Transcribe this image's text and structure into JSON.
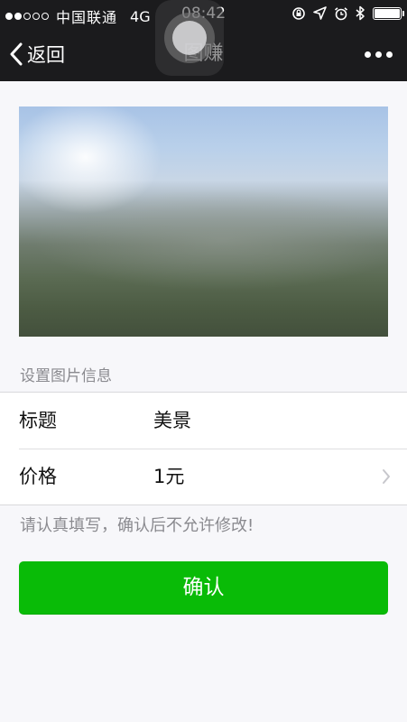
{
  "status_bar": {
    "signal_dots": {
      "filled": 2,
      "total": 5
    },
    "carrier": "中国联通",
    "network": "4G",
    "time": "08:42",
    "battery_level": 1.0
  },
  "nav": {
    "back_label": "返回",
    "title": "图赚",
    "more_icon": "more-dots-icon"
  },
  "photo": {
    "description_icon": "landscape-photo"
  },
  "form": {
    "section_label": "设置图片信息",
    "rows": [
      {
        "label": "标题",
        "value": "美景"
      },
      {
        "label": "价格",
        "value": "1元"
      }
    ],
    "note": "请认真填写，确认后不允许修改!"
  },
  "actions": {
    "confirm_label": "确认"
  },
  "colors": {
    "status_bg": "#1b1b1d",
    "page_bg": "#f7f7fa",
    "accent_green": "#09bb07",
    "secondary_text": "#8a8a8f"
  }
}
